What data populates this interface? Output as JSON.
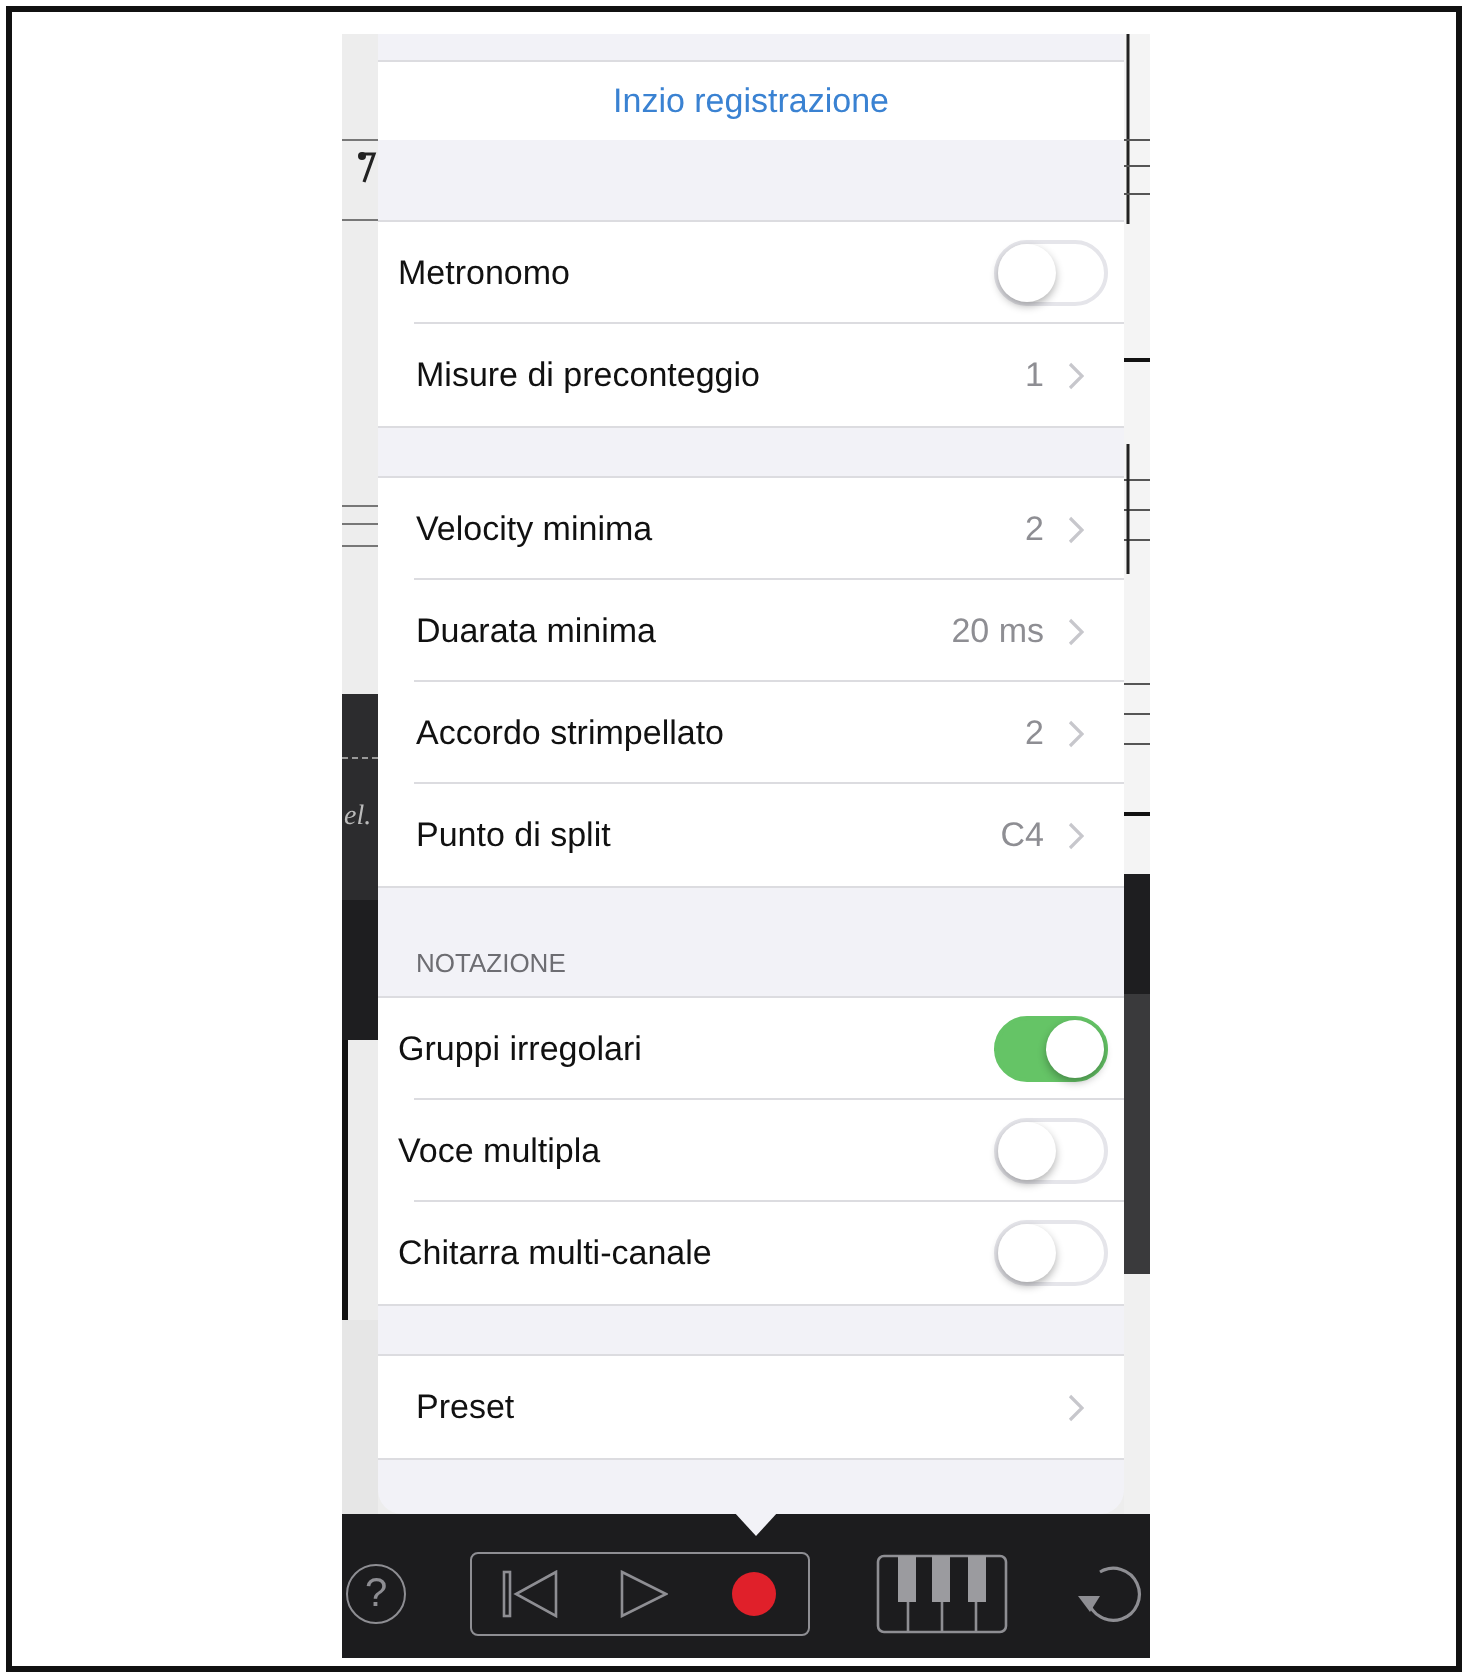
{
  "score": {
    "fragment": "el."
  },
  "popover": {
    "title": "Inzio registrazione",
    "sections": [
      {
        "rows": [
          {
            "kind": "switch",
            "label": "Metronomo",
            "on": false
          },
          {
            "kind": "disclosure",
            "label": "Misure di preconteggio",
            "value": "1"
          }
        ]
      },
      {
        "rows": [
          {
            "kind": "disclosure",
            "label": "Velocity minima",
            "value": "2"
          },
          {
            "kind": "disclosure",
            "label": "Duarata minima",
            "value": "20 ms"
          },
          {
            "kind": "disclosure",
            "label": "Accordo strimpellato",
            "value": "2"
          },
          {
            "kind": "disclosure",
            "label": "Punto di split",
            "value": "C4"
          }
        ]
      },
      {
        "header": "NOTAZIONE",
        "rows": [
          {
            "kind": "switch",
            "label": "Gruppi irregolari",
            "on": true
          },
          {
            "kind": "switch",
            "label": "Voce multipla",
            "on": false
          },
          {
            "kind": "switch",
            "label": "Chitarra multi-canale",
            "on": false
          }
        ]
      },
      {
        "rows": [
          {
            "kind": "disclosure",
            "label": "Preset"
          }
        ]
      }
    ]
  },
  "toolbar": {
    "help": "?"
  }
}
